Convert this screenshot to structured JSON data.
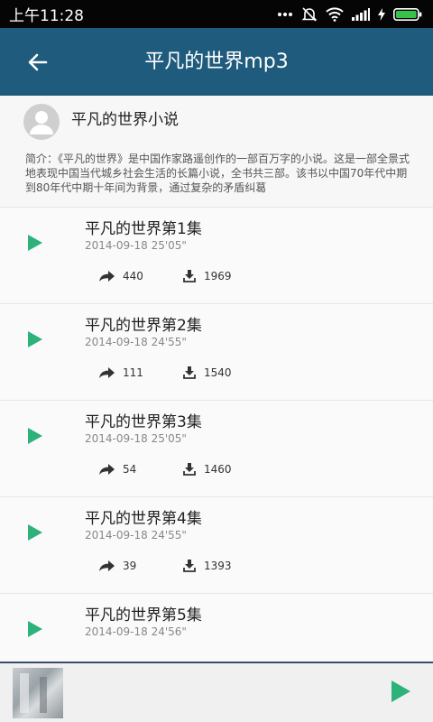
{
  "status_bar": {
    "time": "上午11:28"
  },
  "app_bar": {
    "title": "平凡的世界mp3"
  },
  "header": {
    "author": "平凡的世界小说",
    "intro": "简介：《平凡的世界》是中国作家路遥创作的一部百万字的小说。这是一部全景式地表现中国当代城乡社会生活的长篇小说，全书共三部。该书以中国70年代中期到80年代中期十年间为背景，通过复杂的矛盾纠葛"
  },
  "episodes": [
    {
      "title": "平凡的世界第1集",
      "date": "2014-09-18",
      "duration": "25'05\"",
      "shares": "440",
      "downloads": "1969"
    },
    {
      "title": "平凡的世界第2集",
      "date": "2014-09-18",
      "duration": "24'55\"",
      "shares": "111",
      "downloads": "1540"
    },
    {
      "title": "平凡的世界第3集",
      "date": "2014-09-18",
      "duration": "25'05\"",
      "shares": "54",
      "downloads": "1460"
    },
    {
      "title": "平凡的世界第4集",
      "date": "2014-09-18",
      "duration": "24'55\"",
      "shares": "39",
      "downloads": "1393"
    },
    {
      "title": "平凡的世界第5集",
      "date": "2014-09-18",
      "duration": "24'56\"",
      "shares": "",
      "downloads": ""
    }
  ],
  "colors": {
    "app_bar": "#1f5b7c",
    "play_accent": "#2db27a",
    "player_border": "#3a4d6a"
  },
  "icons": {
    "back": "arrow-back-icon",
    "play": "play-icon",
    "share": "share-icon",
    "download": "download-icon",
    "avatar": "person-icon"
  }
}
